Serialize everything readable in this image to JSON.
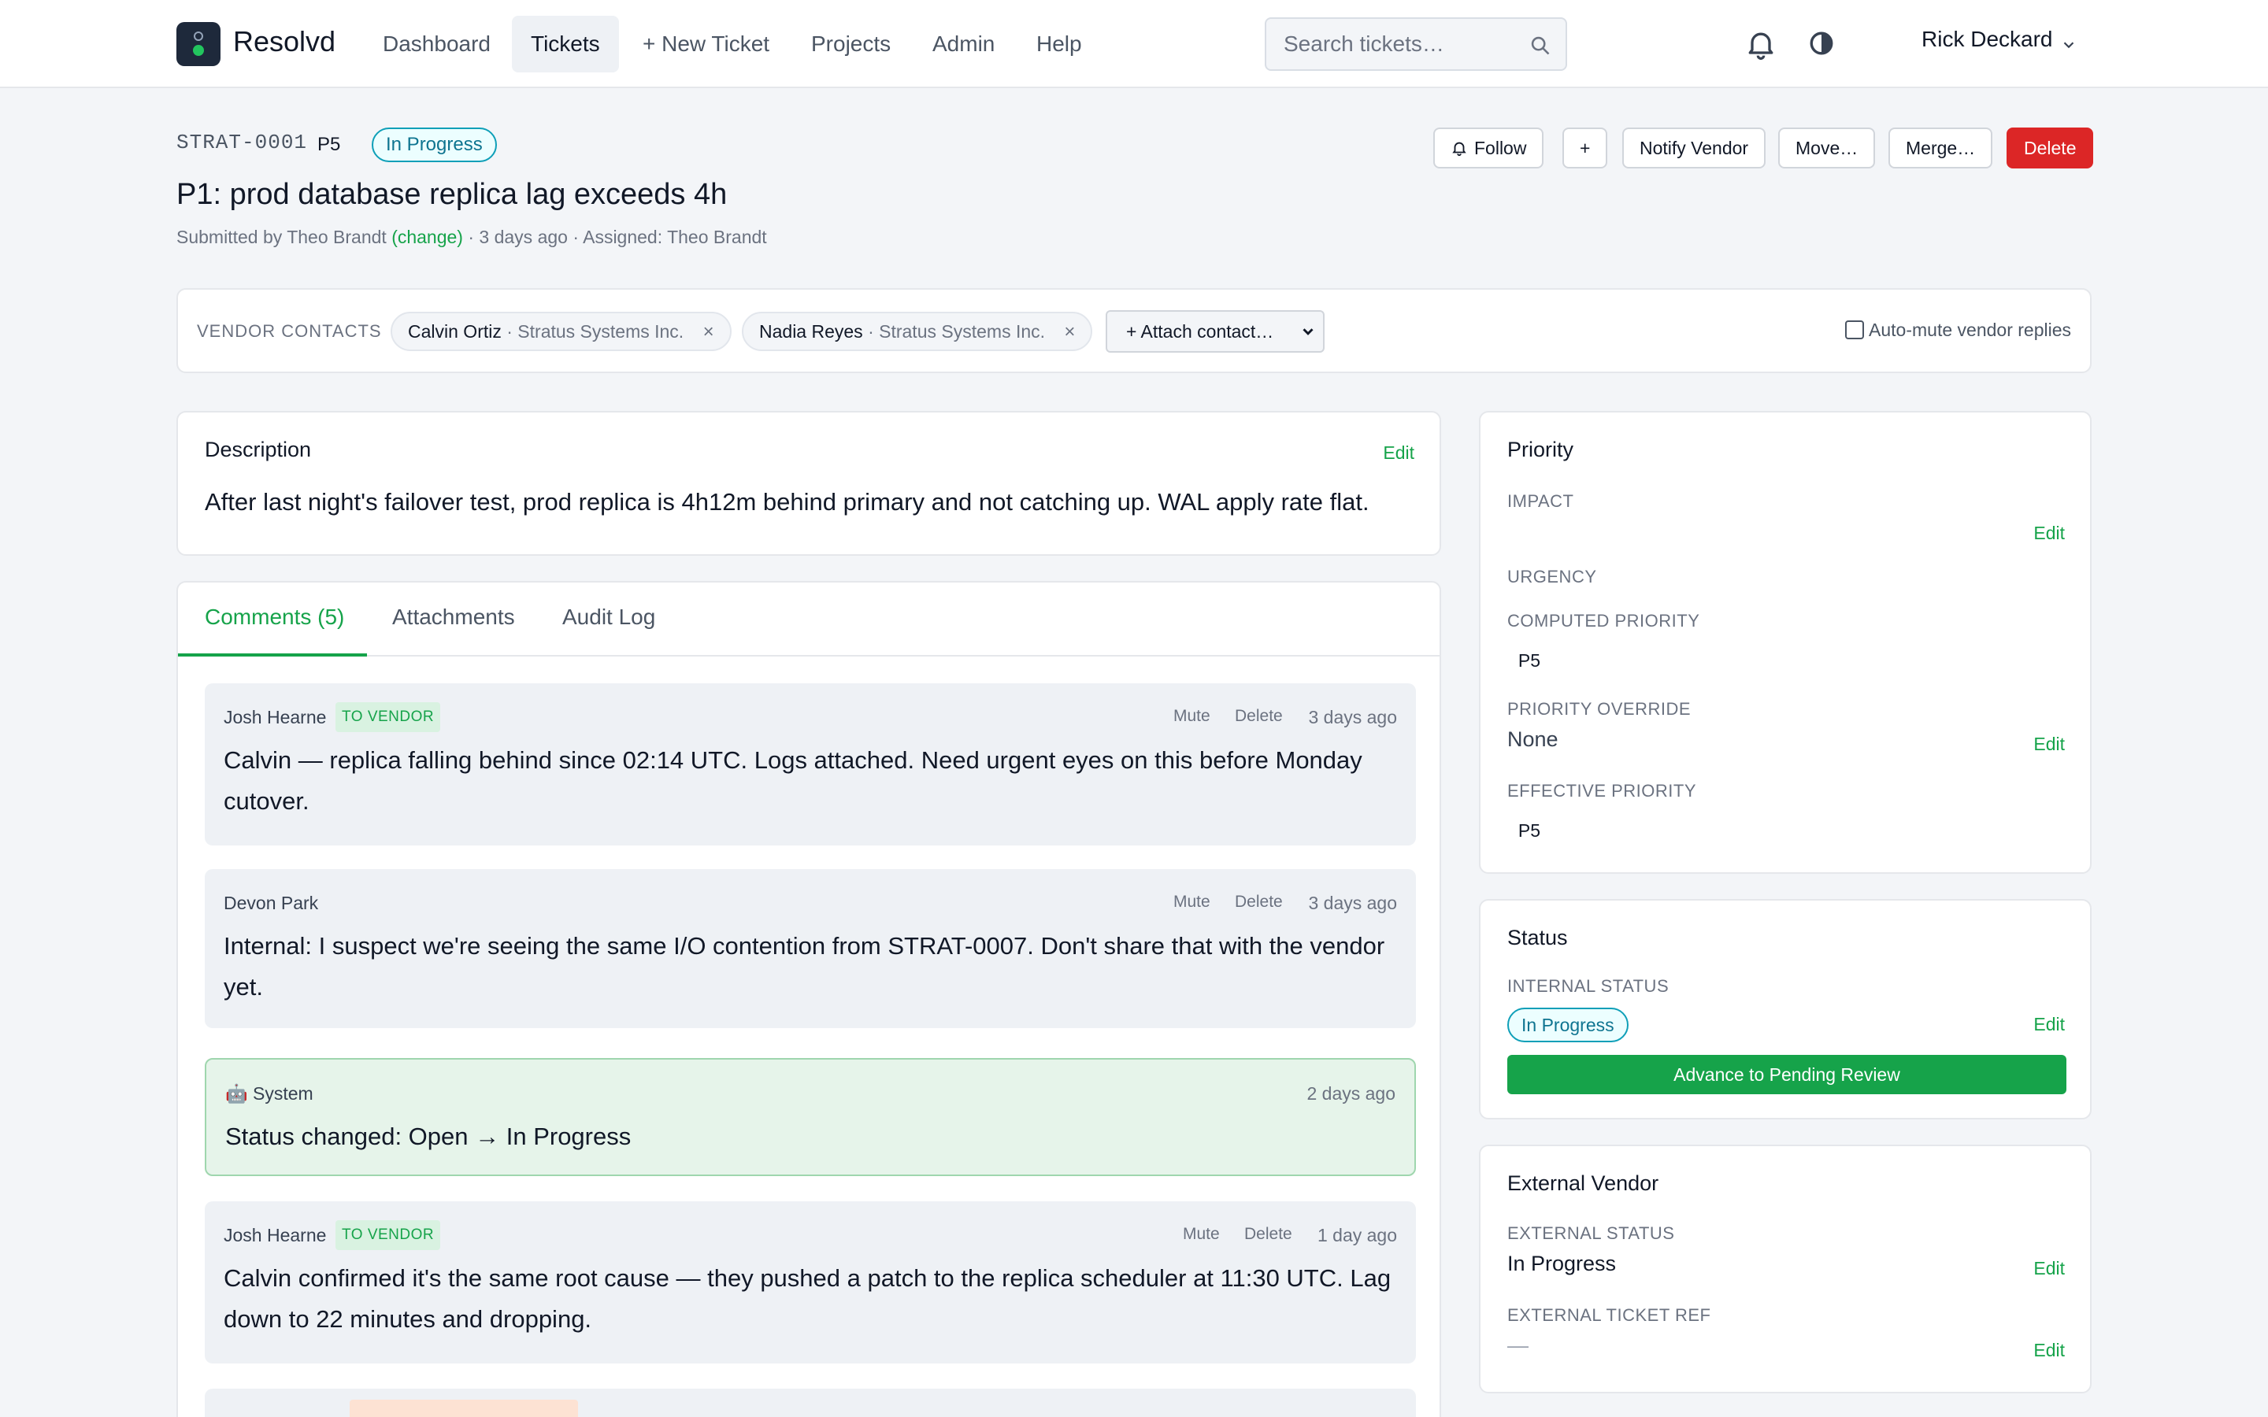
{
  "app": {
    "brand": "Resolvd",
    "nav": [
      "Dashboard",
      "Tickets",
      "+ New Ticket",
      "Projects",
      "Admin",
      "Help"
    ],
    "active_nav": "Tickets",
    "search_placeholder": "Search tickets…",
    "user_name": "Rick Deckard"
  },
  "ticket": {
    "id": "STRAT-0001",
    "priority_chip": "P5",
    "status": "In Progress",
    "title": "P1: prod database replica lag exceeds 4h",
    "submitted_prefix": "Submitted by Theo Brandt",
    "change_link": "(change)",
    "submitted_suffix": "· 3 days ago · Assigned: Theo Brandt",
    "actions": {
      "follow": "Follow",
      "plus": "+",
      "notify_vendor": "Notify Vendor",
      "move": "Move…",
      "merge": "Merge…",
      "delete": "Delete"
    }
  },
  "vendor_contacts": {
    "label": "VENDOR CONTACTS",
    "contacts": [
      {
        "name": "Calvin Ortiz",
        "company": "· Stratus Systems Inc.",
        "remove": "×"
      },
      {
        "name": "Nadia Reyes",
        "company": "· Stratus Systems Inc.",
        "remove": "×"
      }
    ],
    "attach_label": "+ Attach contact…",
    "auto_mute_label": "Auto-mute vendor replies",
    "auto_mute_checked": false
  },
  "description": {
    "title": "Description",
    "edit": "Edit",
    "text": "After last night's failover test, prod replica is 4h12m behind primary and not catching up. WAL apply rate flat."
  },
  "tabs": [
    {
      "label": "Comments (5)",
      "active": true
    },
    {
      "label": "Attachments",
      "active": false
    },
    {
      "label": "Audit Log",
      "active": false
    }
  ],
  "comments": [
    {
      "author": "Josh Hearne",
      "badge": "TO VENDOR",
      "mute": "Mute",
      "delete": "Delete",
      "time": "3 days ago",
      "body": "Calvin — replica falling behind since 02:14 UTC. Logs attached. Need urgent eyes on this before Monday cutover."
    },
    {
      "author": "Devon Park",
      "mute": "Mute",
      "delete": "Delete",
      "time": "3 days ago",
      "body": "Internal: I suspect we're seeing the same I/O contention from STRAT-0007. Don't share that with the vendor yet."
    },
    {
      "author": "🤖 System",
      "time": "2 days ago",
      "body": "Status changed: Open → In Progress"
    },
    {
      "author": "Josh Hearne",
      "badge": "TO VENDOR",
      "mute": "Mute",
      "delete": "Delete",
      "time": "1 day ago",
      "body": "Calvin confirmed it's the same root cause — they pushed a patch to the replica scheduler at 11:30 UTC. Lag down to 22 minutes and dropping."
    }
  ],
  "priority_card": {
    "title": "Priority",
    "impact_label": "IMPACT",
    "impact_edit": "Edit",
    "urgency_label": "URGENCY",
    "computed_label": "COMPUTED PRIORITY",
    "computed_value": "P5",
    "override_label": "PRIORITY OVERRIDE",
    "override_value": "None",
    "override_edit": "Edit",
    "effective_label": "EFFECTIVE PRIORITY",
    "effective_value": "P5"
  },
  "status_card": {
    "title": "Status",
    "internal_label": "INTERNAL STATUS",
    "internal_value": "In Progress",
    "edit": "Edit",
    "advance_button": "Advance to Pending Review"
  },
  "vendor_card": {
    "title": "External Vendor",
    "ext_status_label": "EXTERNAL STATUS",
    "ext_status_value": "In Progress",
    "ext_status_edit": "Edit",
    "ext_ref_label": "EXTERNAL TICKET REF",
    "ext_ref_value": "—",
    "ext_ref_edit": "Edit"
  },
  "colors": {
    "accent_green": "#16a34a",
    "status_teal": "#0e9fb8",
    "danger_red": "#dc2626",
    "vendor_badge_bg": "#d9f2e1",
    "system_comment_bg": "#e6f4ea"
  }
}
